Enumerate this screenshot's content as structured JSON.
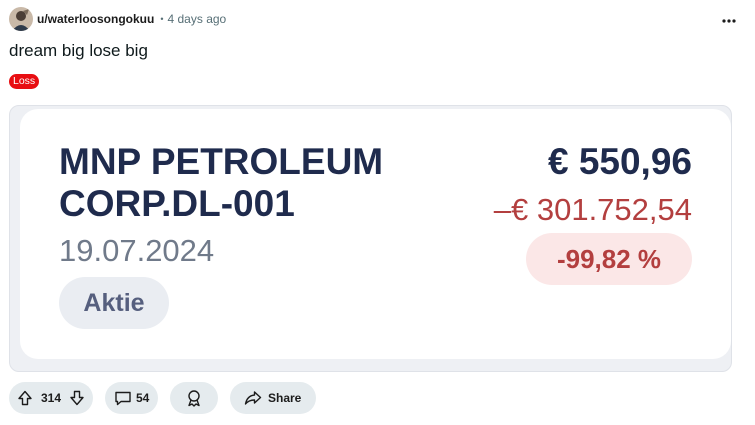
{
  "post": {
    "author": "u/waterloosongokuu",
    "separator": "•",
    "time_ago": "4 days ago",
    "title": "dream big lose big",
    "flair": "Loss"
  },
  "card": {
    "name_line1": "MNP PETROLEUM",
    "name_line2": "CORP.DL-001",
    "date": "19.07.2024",
    "type": "Aktie",
    "price": "€ 550,96",
    "change": "–€ 301.752,54",
    "change_pct": "-99,82 %"
  },
  "actions": {
    "vote_count": "314",
    "comment_count": "54",
    "share_label": "Share"
  },
  "icons": {
    "menu": "more-horizontal-icon",
    "upvote": "arrow-up-icon",
    "downvote": "arrow-down-icon",
    "comment": "comment-bubble-icon",
    "award": "award-icon",
    "share": "share-arrow-icon"
  },
  "colors": {
    "flair_bg": "#e80e12",
    "navy_text": "#1f2b4d",
    "loss_red": "#b33f3f",
    "loss_badge_bg": "#fbe7e7",
    "pill_bg": "#e5ebee"
  }
}
